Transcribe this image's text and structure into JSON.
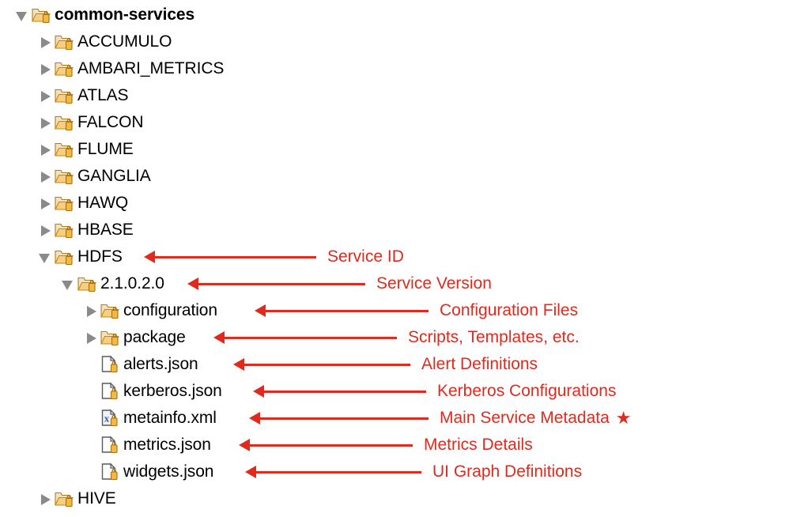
{
  "theme": {
    "annotation_color": "#e02a1e",
    "text_color": "#000000",
    "folder_color": "#e8a33d",
    "twisty_color": "#8a8a8a",
    "background": "#ffffff"
  },
  "tree": {
    "root_label": "common-services",
    "rows": [
      {
        "label": "common-services",
        "icon": "folder-locked-icon",
        "type": "folder",
        "state": "expanded",
        "depth": 0,
        "bold": true
      },
      {
        "label": "ACCUMULO",
        "icon": "folder-locked-icon",
        "type": "folder",
        "state": "collapsed",
        "depth": 1,
        "bold": false
      },
      {
        "label": "AMBARI_METRICS",
        "icon": "folder-locked-icon",
        "type": "folder",
        "state": "collapsed",
        "depth": 1,
        "bold": false
      },
      {
        "label": "ATLAS",
        "icon": "folder-locked-icon",
        "type": "folder",
        "state": "collapsed",
        "depth": 1,
        "bold": false
      },
      {
        "label": "FALCON",
        "icon": "folder-locked-icon",
        "type": "folder",
        "state": "collapsed",
        "depth": 1,
        "bold": false
      },
      {
        "label": "FLUME",
        "icon": "folder-locked-icon",
        "type": "folder",
        "state": "collapsed",
        "depth": 1,
        "bold": false
      },
      {
        "label": "GANGLIA",
        "icon": "folder-locked-icon",
        "type": "folder",
        "state": "collapsed",
        "depth": 1,
        "bold": false
      },
      {
        "label": "HAWQ",
        "icon": "folder-locked-icon",
        "type": "folder",
        "state": "collapsed",
        "depth": 1,
        "bold": false
      },
      {
        "label": "HBASE",
        "icon": "folder-locked-icon",
        "type": "folder",
        "state": "collapsed",
        "depth": 1,
        "bold": false
      },
      {
        "label": "HDFS",
        "icon": "folder-locked-icon",
        "type": "folder",
        "state": "expanded",
        "depth": 1,
        "bold": false
      },
      {
        "label": "2.1.0.2.0",
        "icon": "folder-locked-icon",
        "type": "folder",
        "state": "expanded",
        "depth": 2,
        "bold": false
      },
      {
        "label": "configuration",
        "icon": "folder-locked-icon",
        "type": "folder",
        "state": "collapsed",
        "depth": 3,
        "bold": false
      },
      {
        "label": "package",
        "icon": "folder-locked-icon",
        "type": "folder",
        "state": "collapsed",
        "depth": 3,
        "bold": false
      },
      {
        "label": "alerts.json",
        "icon": "json-file-icon",
        "type": "file",
        "state": "none",
        "depth": 3,
        "bold": false
      },
      {
        "label": "kerberos.json",
        "icon": "json-file-icon",
        "type": "file",
        "state": "none",
        "depth": 3,
        "bold": false
      },
      {
        "label": "metainfo.xml",
        "icon": "xml-file-icon",
        "type": "file",
        "state": "none",
        "depth": 3,
        "bold": false
      },
      {
        "label": "metrics.json",
        "icon": "json-file-icon",
        "type": "file",
        "state": "none",
        "depth": 3,
        "bold": false
      },
      {
        "label": "widgets.json",
        "icon": "json-file-icon",
        "type": "file",
        "state": "none",
        "depth": 3,
        "bold": false
      },
      {
        "label": "HIVE",
        "icon": "folder-locked-icon",
        "type": "folder",
        "state": "collapsed",
        "depth": 1,
        "bold": false
      }
    ]
  },
  "annotations": [
    {
      "target": "HDFS",
      "text": "Service ID",
      "star": ""
    },
    {
      "target": "2.1.0.2.0",
      "text": "Service Version",
      "star": ""
    },
    {
      "target": "configuration",
      "text": "Configuration Files",
      "star": ""
    },
    {
      "target": "package",
      "text": "Scripts, Templates, etc.",
      "star": ""
    },
    {
      "target": "alerts.json",
      "text": "Alert Definitions",
      "star": ""
    },
    {
      "target": "kerberos.json",
      "text": "Kerberos Configurations",
      "star": ""
    },
    {
      "target": "metainfo.xml",
      "text": "Main Service Metadata",
      "star": "★"
    },
    {
      "target": "metrics.json",
      "text": "Metrics Details",
      "star": ""
    },
    {
      "target": "widgets.json",
      "text": "UI Graph Definitions",
      "star": ""
    }
  ]
}
